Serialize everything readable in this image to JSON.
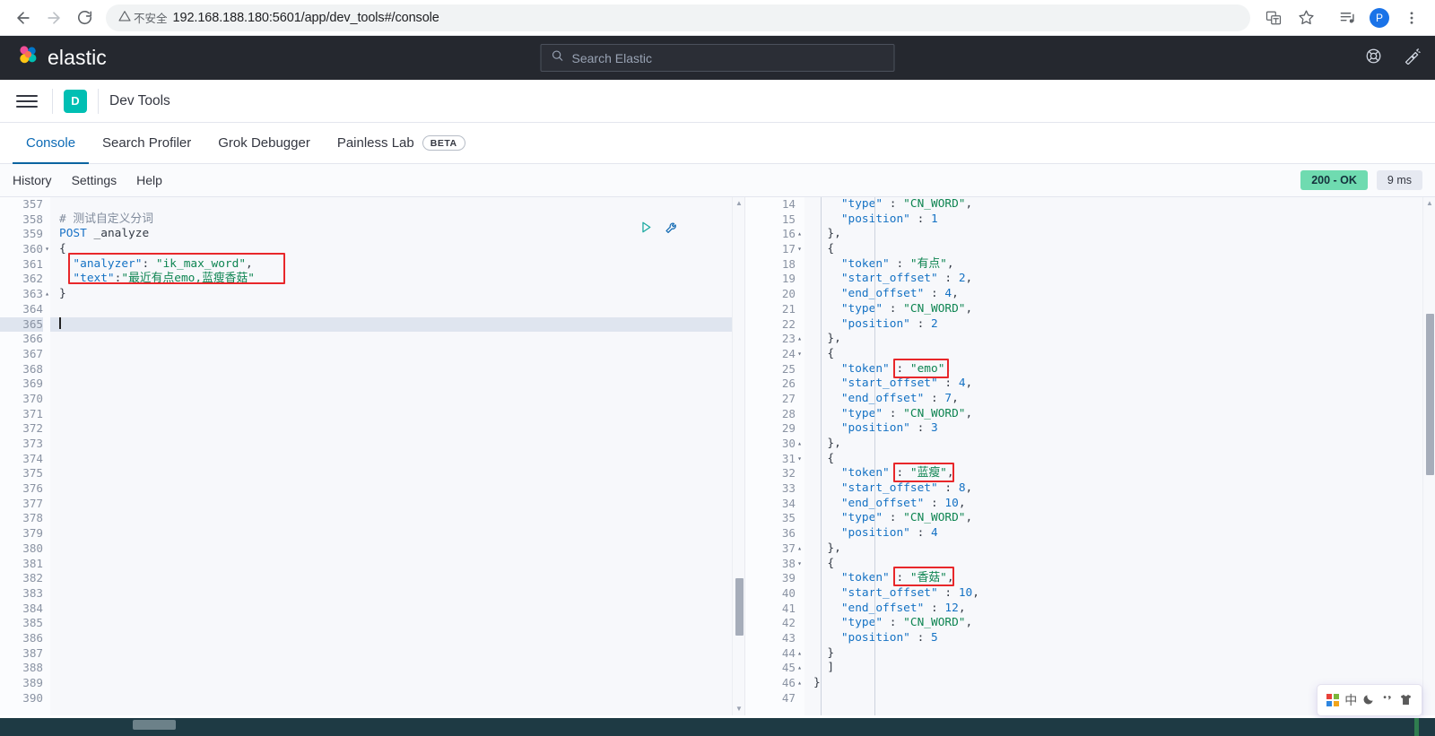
{
  "browser": {
    "back_icon": "back-arrow-icon",
    "forward_icon": "forward-arrow-icon",
    "reload_icon": "reload-icon",
    "security_label": "不安全",
    "url": "192.168.188.180:5601/app/dev_tools#/console",
    "translate_icon": "translate-icon",
    "bookmark_icon": "star-icon",
    "media_icon": "media-control-icon",
    "profile_initial": "P",
    "menu_icon": "three-dots-menu-icon"
  },
  "elastic_header": {
    "brand": "elastic",
    "search_placeholder": "Search Elastic",
    "help_icon": "lifering-help-icon",
    "news_icon": "megaphone-news-icon"
  },
  "app_bar": {
    "menu_icon": "hamburger-menu-icon",
    "app_badge": "D",
    "title": "Dev Tools"
  },
  "tabs": [
    {
      "label": "Console",
      "active": true
    },
    {
      "label": "Search Profiler",
      "active": false
    },
    {
      "label": "Grok Debugger",
      "active": false
    },
    {
      "label": "Painless Lab",
      "active": false,
      "badge": "BETA"
    }
  ],
  "console_toolbar": {
    "links": [
      "History",
      "Settings",
      "Help"
    ],
    "status": "200 - OK",
    "time": "9 ms"
  },
  "request_editor": {
    "first_line_number": 357,
    "last_line_number": 390,
    "cursor_line": 365,
    "play_icon": "play-request-icon",
    "wrench_icon": "wrench-docs-icon",
    "lines": [
      {
        "n": 357,
        "segments": []
      },
      {
        "n": 358,
        "segments": [
          {
            "t": "comment",
            "v": "# 测试自定义分词"
          }
        ]
      },
      {
        "n": 359,
        "segments": [
          {
            "t": "method",
            "v": "POST"
          },
          {
            "t": "url",
            "v": " _analyze"
          }
        ]
      },
      {
        "n": 360,
        "fold": "open",
        "segments": [
          {
            "t": "brace",
            "v": "{"
          }
        ]
      },
      {
        "n": 361,
        "segments": [
          {
            "t": "key",
            "v": "  \"analyzer\""
          },
          {
            "t": "punct",
            "v": ": "
          },
          {
            "t": "str",
            "v": "\"ik_max_word\""
          },
          {
            "t": "punct",
            "v": ","
          }
        ]
      },
      {
        "n": 362,
        "segments": [
          {
            "t": "key",
            "v": "  \"text\""
          },
          {
            "t": "punct",
            "v": ":"
          },
          {
            "t": "str",
            "v": "\"最近有点emo,蓝瘦香菇\""
          }
        ]
      },
      {
        "n": 363,
        "fold": "close",
        "segments": [
          {
            "t": "brace",
            "v": "}"
          }
        ]
      },
      {
        "n": 364,
        "segments": []
      },
      {
        "n": 365,
        "segments": [],
        "cursor": true
      },
      {
        "n": 366,
        "segments": []
      },
      {
        "n": 367,
        "segments": []
      },
      {
        "n": 368,
        "segments": []
      },
      {
        "n": 369,
        "segments": []
      },
      {
        "n": 370,
        "segments": []
      },
      {
        "n": 371,
        "segments": []
      },
      {
        "n": 372,
        "segments": []
      },
      {
        "n": 373,
        "segments": []
      },
      {
        "n": 374,
        "segments": []
      },
      {
        "n": 375,
        "segments": []
      },
      {
        "n": 376,
        "segments": []
      },
      {
        "n": 377,
        "segments": []
      },
      {
        "n": 378,
        "segments": []
      },
      {
        "n": 379,
        "segments": []
      },
      {
        "n": 380,
        "segments": []
      },
      {
        "n": 381,
        "segments": []
      },
      {
        "n": 382,
        "segments": []
      },
      {
        "n": 383,
        "segments": []
      },
      {
        "n": 384,
        "segments": []
      },
      {
        "n": 385,
        "segments": []
      },
      {
        "n": 386,
        "segments": []
      },
      {
        "n": 387,
        "segments": []
      },
      {
        "n": 388,
        "segments": []
      },
      {
        "n": 389,
        "segments": []
      },
      {
        "n": 390,
        "segments": []
      }
    ],
    "annotation_box": {
      "label": "request-body-highlight",
      "color": "#e8272a"
    }
  },
  "response_editor": {
    "first_line_number": 14,
    "last_line_number": 47,
    "lines": [
      {
        "n": 14,
        "segments": [
          {
            "t": "key",
            "v": "    \"type\""
          },
          {
            "t": "punct",
            "v": " : "
          },
          {
            "t": "str",
            "v": "\"CN_WORD\""
          },
          {
            "t": "punct",
            "v": ","
          }
        ]
      },
      {
        "n": 15,
        "segments": [
          {
            "t": "key",
            "v": "    \"position\""
          },
          {
            "t": "punct",
            "v": " : "
          },
          {
            "t": "num",
            "v": "1"
          }
        ]
      },
      {
        "n": 16,
        "fold": "close",
        "segments": [
          {
            "t": "brace",
            "v": "  },"
          }
        ]
      },
      {
        "n": 17,
        "fold": "open",
        "segments": [
          {
            "t": "brace",
            "v": "  {"
          }
        ]
      },
      {
        "n": 18,
        "segments": [
          {
            "t": "key",
            "v": "    \"token\""
          },
          {
            "t": "punct",
            "v": " : "
          },
          {
            "t": "str",
            "v": "\"有点\""
          },
          {
            "t": "punct",
            "v": ","
          }
        ]
      },
      {
        "n": 19,
        "segments": [
          {
            "t": "key",
            "v": "    \"start_offset\""
          },
          {
            "t": "punct",
            "v": " : "
          },
          {
            "t": "num",
            "v": "2"
          },
          {
            "t": "punct",
            "v": ","
          }
        ]
      },
      {
        "n": 20,
        "segments": [
          {
            "t": "key",
            "v": "    \"end_offset\""
          },
          {
            "t": "punct",
            "v": " : "
          },
          {
            "t": "num",
            "v": "4"
          },
          {
            "t": "punct",
            "v": ","
          }
        ]
      },
      {
        "n": 21,
        "segments": [
          {
            "t": "key",
            "v": "    \"type\""
          },
          {
            "t": "punct",
            "v": " : "
          },
          {
            "t": "str",
            "v": "\"CN_WORD\""
          },
          {
            "t": "punct",
            "v": ","
          }
        ]
      },
      {
        "n": 22,
        "segments": [
          {
            "t": "key",
            "v": "    \"position\""
          },
          {
            "t": "punct",
            "v": " : "
          },
          {
            "t": "num",
            "v": "2"
          }
        ]
      },
      {
        "n": 23,
        "fold": "close",
        "segments": [
          {
            "t": "brace",
            "v": "  },"
          }
        ]
      },
      {
        "n": 24,
        "fold": "open",
        "segments": [
          {
            "t": "brace",
            "v": "  {"
          }
        ]
      },
      {
        "n": 25,
        "segments": [
          {
            "t": "key",
            "v": "    \"token\""
          },
          {
            "t": "punct",
            "v": " : "
          },
          {
            "t": "str",
            "v": "\"emo\""
          },
          {
            "t": "punct",
            "v": ","
          }
        ]
      },
      {
        "n": 26,
        "segments": [
          {
            "t": "key",
            "v": "    \"start_offset\""
          },
          {
            "t": "punct",
            "v": " : "
          },
          {
            "t": "num",
            "v": "4"
          },
          {
            "t": "punct",
            "v": ","
          }
        ]
      },
      {
        "n": 27,
        "segments": [
          {
            "t": "key",
            "v": "    \"end_offset\""
          },
          {
            "t": "punct",
            "v": " : "
          },
          {
            "t": "num",
            "v": "7"
          },
          {
            "t": "punct",
            "v": ","
          }
        ]
      },
      {
        "n": 28,
        "segments": [
          {
            "t": "key",
            "v": "    \"type\""
          },
          {
            "t": "punct",
            "v": " : "
          },
          {
            "t": "str",
            "v": "\"CN_WORD\""
          },
          {
            "t": "punct",
            "v": ","
          }
        ]
      },
      {
        "n": 29,
        "segments": [
          {
            "t": "key",
            "v": "    \"position\""
          },
          {
            "t": "punct",
            "v": " : "
          },
          {
            "t": "num",
            "v": "3"
          }
        ]
      },
      {
        "n": 30,
        "fold": "close",
        "segments": [
          {
            "t": "brace",
            "v": "  },"
          }
        ]
      },
      {
        "n": 31,
        "fold": "open",
        "segments": [
          {
            "t": "brace",
            "v": "  {"
          }
        ]
      },
      {
        "n": 32,
        "segments": [
          {
            "t": "key",
            "v": "    \"token\""
          },
          {
            "t": "punct",
            "v": " : "
          },
          {
            "t": "str",
            "v": "\"蓝瘦\""
          },
          {
            "t": "punct",
            "v": ","
          }
        ]
      },
      {
        "n": 33,
        "segments": [
          {
            "t": "key",
            "v": "    \"start_offset\""
          },
          {
            "t": "punct",
            "v": " : "
          },
          {
            "t": "num",
            "v": "8"
          },
          {
            "t": "punct",
            "v": ","
          }
        ]
      },
      {
        "n": 34,
        "segments": [
          {
            "t": "key",
            "v": "    \"end_offset\""
          },
          {
            "t": "punct",
            "v": " : "
          },
          {
            "t": "num",
            "v": "10"
          },
          {
            "t": "punct",
            "v": ","
          }
        ]
      },
      {
        "n": 35,
        "segments": [
          {
            "t": "key",
            "v": "    \"type\""
          },
          {
            "t": "punct",
            "v": " : "
          },
          {
            "t": "str",
            "v": "\"CN_WORD\""
          },
          {
            "t": "punct",
            "v": ","
          }
        ]
      },
      {
        "n": 36,
        "segments": [
          {
            "t": "key",
            "v": "    \"position\""
          },
          {
            "t": "punct",
            "v": " : "
          },
          {
            "t": "num",
            "v": "4"
          }
        ]
      },
      {
        "n": 37,
        "fold": "close",
        "segments": [
          {
            "t": "brace",
            "v": "  },"
          }
        ]
      },
      {
        "n": 38,
        "fold": "open",
        "segments": [
          {
            "t": "brace",
            "v": "  {"
          }
        ]
      },
      {
        "n": 39,
        "segments": [
          {
            "t": "key",
            "v": "    \"token\""
          },
          {
            "t": "punct",
            "v": " : "
          },
          {
            "t": "str",
            "v": "\"香菇\""
          },
          {
            "t": "punct",
            "v": ","
          }
        ]
      },
      {
        "n": 40,
        "segments": [
          {
            "t": "key",
            "v": "    \"start_offset\""
          },
          {
            "t": "punct",
            "v": " : "
          },
          {
            "t": "num",
            "v": "10"
          },
          {
            "t": "punct",
            "v": ","
          }
        ]
      },
      {
        "n": 41,
        "segments": [
          {
            "t": "key",
            "v": "    \"end_offset\""
          },
          {
            "t": "punct",
            "v": " : "
          },
          {
            "t": "num",
            "v": "12"
          },
          {
            "t": "punct",
            "v": ","
          }
        ]
      },
      {
        "n": 42,
        "segments": [
          {
            "t": "key",
            "v": "    \"type\""
          },
          {
            "t": "punct",
            "v": " : "
          },
          {
            "t": "str",
            "v": "\"CN_WORD\""
          },
          {
            "t": "punct",
            "v": ","
          }
        ]
      },
      {
        "n": 43,
        "segments": [
          {
            "t": "key",
            "v": "    \"position\""
          },
          {
            "t": "punct",
            "v": " : "
          },
          {
            "t": "num",
            "v": "5"
          }
        ]
      },
      {
        "n": 44,
        "fold": "close",
        "segments": [
          {
            "t": "brace",
            "v": "  }"
          }
        ]
      },
      {
        "n": 45,
        "fold": "close",
        "segments": [
          {
            "t": "brace",
            "v": "  ]"
          }
        ]
      },
      {
        "n": 46,
        "fold": "close",
        "segments": [
          {
            "t": "brace",
            "v": "}"
          }
        ]
      },
      {
        "n": 47,
        "segments": []
      }
    ],
    "annotations": [
      {
        "label": "token-emo-highlight",
        "line": 25,
        "color": "#e8272a"
      },
      {
        "label": "token-lanshou-highlight",
        "line": 32,
        "color": "#e8272a"
      },
      {
        "label": "token-xianggu-highlight",
        "line": 39,
        "color": "#e8272a"
      }
    ]
  },
  "ime_bar": {
    "logo_icon": "ime-logo-icon",
    "mode": "中",
    "moon_icon": "moon-icon",
    "punctuation_icon": "punctuation-icon",
    "skin_icon": "skin-shirt-icon"
  }
}
